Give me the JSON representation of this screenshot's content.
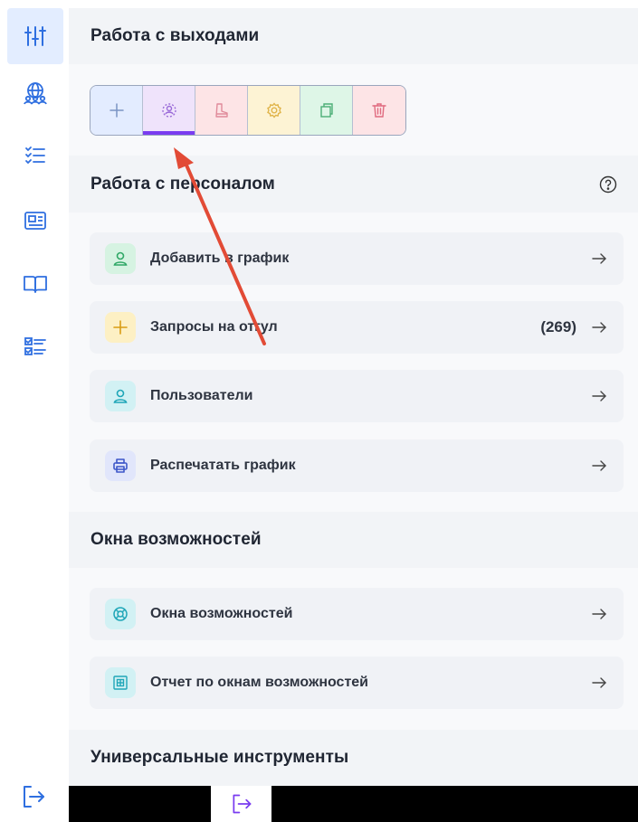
{
  "sidebar": {
    "items": [
      {
        "icon": "sliders-icon",
        "active": true
      },
      {
        "icon": "people-globe-icon",
        "active": false
      },
      {
        "icon": "checklist-icon",
        "active": false
      },
      {
        "icon": "id-card-icon",
        "active": false
      },
      {
        "icon": "book-icon",
        "active": false
      },
      {
        "icon": "checkbox-list-icon",
        "active": false
      }
    ],
    "logout_icon": "logout-icon"
  },
  "sections": {
    "shifts": {
      "title": "Работа с выходами"
    },
    "staff": {
      "title": "Работа с персоналом",
      "help_icon": "help-circle-icon"
    },
    "opportunities": {
      "title": "Окна возможностей"
    },
    "tools": {
      "title": "Универсальные инструменты"
    }
  },
  "toolbar": {
    "buttons": [
      {
        "icon": "plus-icon",
        "color": "#e3ecff",
        "active": false
      },
      {
        "icon": "user-search-icon",
        "color": "#efe3fb",
        "active": true
      },
      {
        "icon": "boot-icon",
        "color": "#fde4e6",
        "active": false
      },
      {
        "icon": "gear-icon",
        "color": "#fdf3d4",
        "active": false
      },
      {
        "icon": "copy-icon",
        "color": "#def6e7",
        "active": false
      },
      {
        "icon": "trash-icon",
        "color": "#fde4e6",
        "active": false
      }
    ]
  },
  "staff_items": [
    {
      "label": "Добавить в график",
      "icon": "user-icon",
      "count": ""
    },
    {
      "label": "Запросы на отгул",
      "icon": "plus-icon",
      "count": "(269)"
    },
    {
      "label": "Пользователи",
      "icon": "user-icon",
      "count": ""
    },
    {
      "label": "Распечатать график",
      "icon": "printer-icon",
      "count": ""
    }
  ],
  "opportunity_items": [
    {
      "label": "Окна возможностей",
      "icon": "lifebuoy-icon"
    },
    {
      "label": "Отчет по окнам возможностей",
      "icon": "report-icon"
    }
  ],
  "colors": {
    "accent": "#7a3cf0",
    "sidebar_active": "#e3edff",
    "section_header": "#f2f4f7",
    "annotation_arrow": "#e24b36"
  }
}
